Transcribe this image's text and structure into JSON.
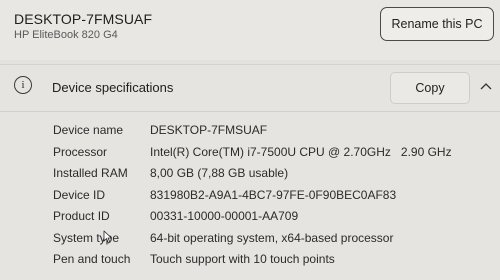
{
  "header": {
    "device_name": "DESKTOP-7FMSUAF",
    "model": "HP EliteBook 820 G4",
    "rename_label": "Rename this PC"
  },
  "device_specs": {
    "title": "Device specifications",
    "copy_label": "Copy",
    "info_icon": "info-icon",
    "rows": [
      {
        "label": "Device name",
        "value": "DESKTOP-7FMSUAF"
      },
      {
        "label": "Processor",
        "value": "Intel(R) Core(TM) i7-7500U CPU @ 2.70GHz   2.90 GHz"
      },
      {
        "label": "Installed RAM",
        "value": "8,00 GB (7,88 GB usable)"
      },
      {
        "label": "Device ID",
        "value": "831980B2-A9A1-4BC7-97FE-0F90BEC0AF83"
      },
      {
        "label": "Product ID",
        "value": "00331-10000-00001-AA709"
      },
      {
        "label": "System type",
        "value": "64-bit operating system, x64-based processor"
      },
      {
        "label": "Pen and touch",
        "value": "Touch support with 10 touch points"
      }
    ]
  }
}
